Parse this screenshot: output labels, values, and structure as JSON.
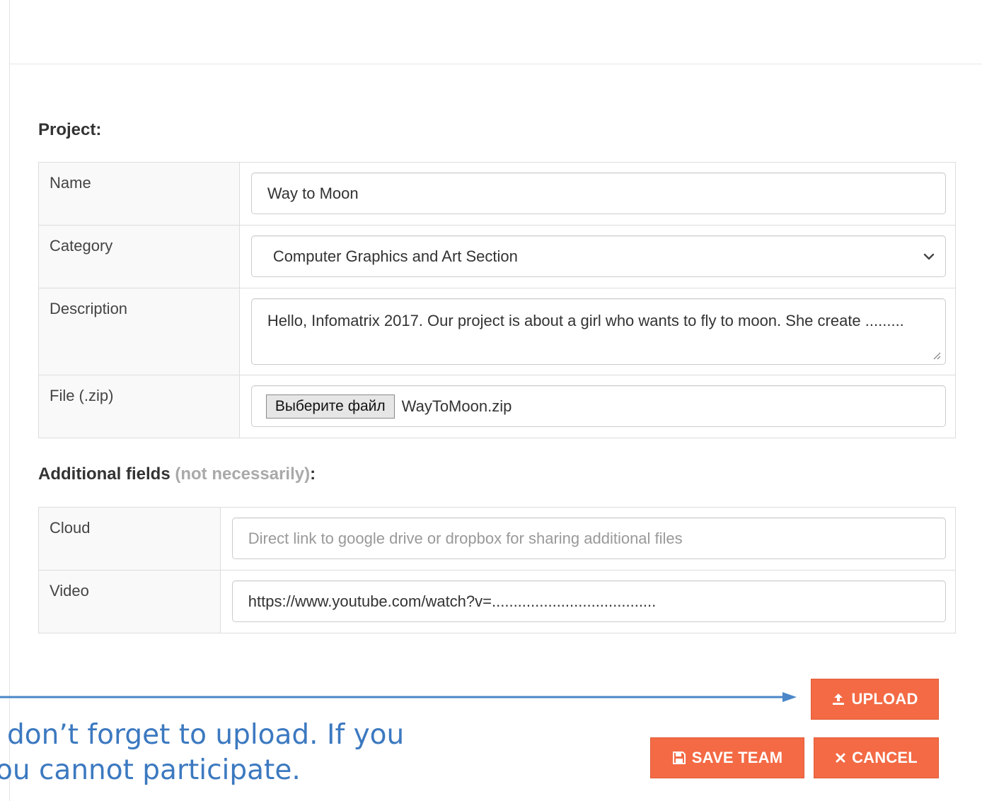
{
  "project_section": {
    "title": "Project:",
    "rows": {
      "name": {
        "label": "Name",
        "value": "Way to Moon"
      },
      "category": {
        "label": "Category",
        "selected": "Computer Graphics and Art Section"
      },
      "description": {
        "label": "Description",
        "value": "Hello, Infomatrix 2017. Our project is about a girl who wants to fly to moon. She create ........."
      },
      "file": {
        "label": "File (.zip)",
        "button_label": "Выберите файл",
        "file_name": "WayToMoon.zip"
      }
    }
  },
  "additional_section": {
    "title": "Additional fields",
    "note": "(not necessarily)",
    "colon": ":",
    "rows": {
      "cloud": {
        "label": "Cloud",
        "placeholder": "Direct link to google drive or dropbox for sharing additional files",
        "value": ""
      },
      "video": {
        "label": "Video",
        "value": "https://www.youtube.com/watch?v=......................................"
      }
    }
  },
  "buttons": {
    "upload": "UPLOAD",
    "save_team": "SAVE TEAM",
    "cancel": "CANCEL"
  },
  "annotation": {
    "line1": "don’t forget to upload. If you",
    "line2": "ou cannot participate."
  },
  "colors": {
    "button": "#f36a45",
    "annotation": "#3c79c0"
  },
  "icons": {
    "upload": "upload-icon",
    "save": "floppy-disk-icon",
    "cancel": "close-icon",
    "select": "chevron-down-icon"
  }
}
